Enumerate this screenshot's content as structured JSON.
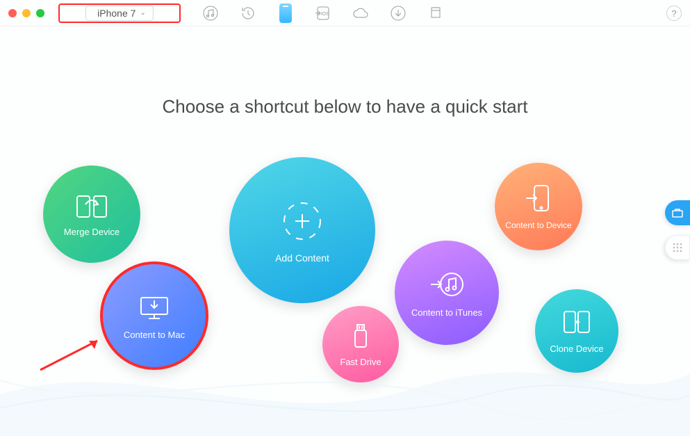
{
  "toolbar": {
    "device_label": "iPhone 7"
  },
  "heading": "Choose a shortcut below to have a quick start",
  "bubbles": {
    "merge": {
      "label": "Merge Device"
    },
    "to_mac": {
      "label": "Content to Mac"
    },
    "add": {
      "label": "Add Content"
    },
    "fast": {
      "label": "Fast Drive"
    },
    "itunes": {
      "label": "Content to iTunes"
    },
    "to_device": {
      "label": "Content to Device"
    },
    "clone": {
      "label": "Clone Device"
    }
  },
  "help": {
    "label": "?"
  }
}
